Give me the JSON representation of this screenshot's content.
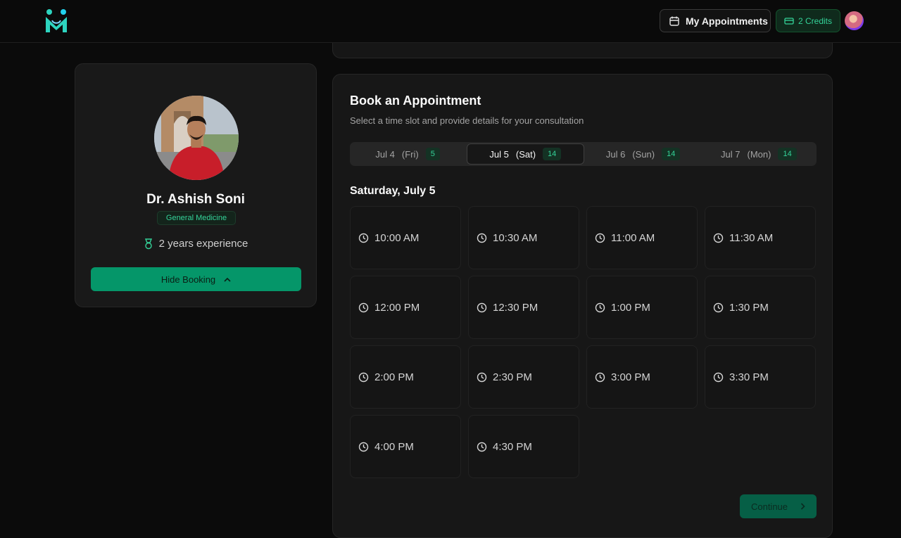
{
  "header": {
    "my_appointments_label": "My Appointments",
    "credits_label": "2 Credits"
  },
  "doctor": {
    "name": "Dr. Ashish Soni",
    "specialty": "General Medicine",
    "experience": "2 years experience",
    "hide_booking_label": "Hide Booking"
  },
  "booking": {
    "title": "Book an Appointment",
    "subtitle": "Select a time slot and provide details for your consultation",
    "selected_day_title": "Saturday, July 5",
    "continue_label": "Continue",
    "tabs": [
      {
        "date": "Jul 4",
        "day": "(Fri)",
        "count": "5"
      },
      {
        "date": "Jul 5",
        "day": "(Sat)",
        "count": "14"
      },
      {
        "date": "Jul 6",
        "day": "(Sun)",
        "count": "14"
      },
      {
        "date": "Jul 7",
        "day": "(Mon)",
        "count": "14"
      }
    ],
    "slots": [
      "10:00 AM",
      "10:30 AM",
      "11:00 AM",
      "11:30 AM",
      "12:00 PM",
      "12:30 PM",
      "1:00 PM",
      "1:30 PM",
      "2:00 PM",
      "2:30 PM",
      "3:00 PM",
      "3:30 PM",
      "4:00 PM",
      "4:30 PM"
    ]
  },
  "colors": {
    "accent": "#059669",
    "accent_text": "#34d399",
    "background": "#0b0b0b",
    "card": "#171717"
  },
  "icons": [
    "calendar-icon",
    "credit-card-icon",
    "medal-icon",
    "chevron-up-icon",
    "clock-icon",
    "chevron-right-icon"
  ]
}
